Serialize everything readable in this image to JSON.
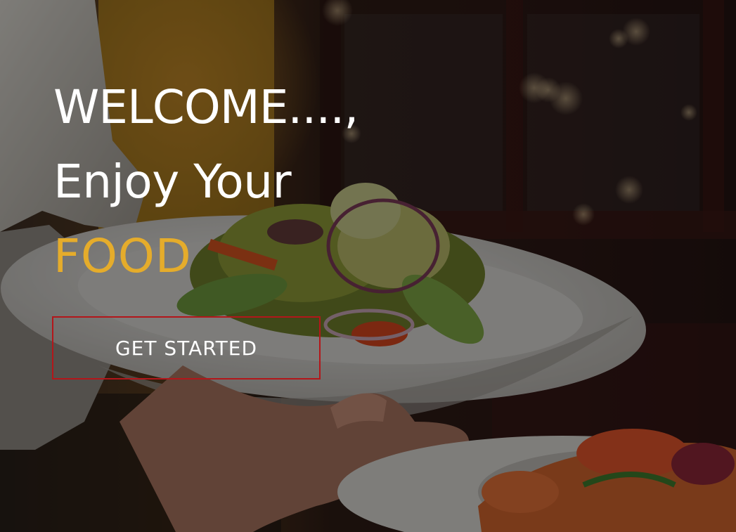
{
  "hero": {
    "headline": {
      "line1": "WELCOME....,",
      "line2": "Enjoy Your",
      "line3": "FOOD"
    },
    "cta_label": "GET STARTED",
    "background_image": "food-plates-photo"
  },
  "colors": {
    "accent": "#e5ac2b",
    "cta_border": "#b3161a",
    "text": "#ffffff",
    "overlay": "#000000"
  }
}
